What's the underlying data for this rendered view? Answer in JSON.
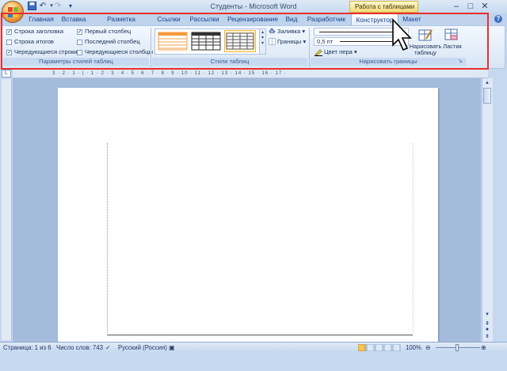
{
  "window": {
    "title": "Студенты - Microsoft Word",
    "context_label": "Работа с таблицами",
    "controls": [
      "–",
      "□",
      "✕"
    ]
  },
  "tabs": [
    "Главная",
    "Вставка",
    "Разметка страницы",
    "Ссылки",
    "Рассылки",
    "Рецензирование",
    "Вид",
    "Разработчик",
    "Конструктор",
    "Макет"
  ],
  "active_tab": "Конструктор",
  "ribbon": {
    "style_options": {
      "items": [
        {
          "label": "Строка заголовка",
          "checked": true
        },
        {
          "label": "Строка итогов",
          "checked": false
        },
        {
          "label": "Чередующиеся строки",
          "checked": true
        },
        {
          "label": "Первый столбец",
          "checked": true
        },
        {
          "label": "Последний столбец",
          "checked": false
        },
        {
          "label": "Чередующиеся столбцы",
          "checked": false
        }
      ],
      "group_label": "Параметры стилей таблиц"
    },
    "table_styles": {
      "group_label": "Стили таблиц",
      "shading_label": "Заливка",
      "borders_label": "Границы"
    },
    "draw_borders": {
      "group_label": "Нарисовать границы",
      "line_weight": "0,5 пт",
      "pen_color_label": "Цвет пера",
      "draw_table_label": "Нарисовать таблицу",
      "eraser_label": "Ластик"
    }
  },
  "ruler_ticks": "3 · 2 · 1 · | · 1 · 2 · 3 · 4 · 5 · 6 · 7 · 8 · 9 · 10 · 11 · 12 · 13 · 14 · 15 · 16 · 17 ·",
  "status": {
    "page": "Страница: 1 из 6",
    "words": "Число слов: 743",
    "language": "Русский (Россия)",
    "zoom": "100%"
  },
  "colors": {
    "highlight": "#e8302e",
    "ribbon_bg": "#dbe7f6",
    "accent": "#f6b04c"
  }
}
